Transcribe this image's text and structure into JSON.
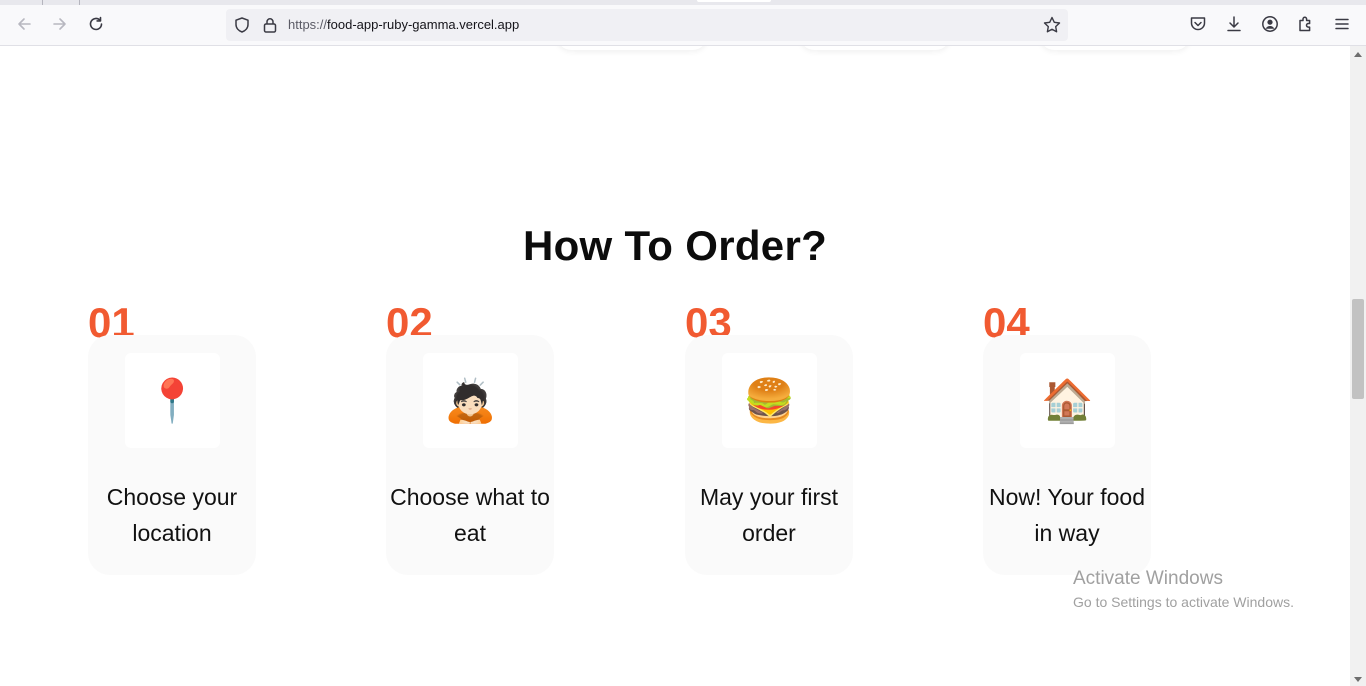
{
  "browser": {
    "url_prefix": "https://",
    "url_host": "food-app-ruby-gamma.vercel.app"
  },
  "section": {
    "title": "How To Order?"
  },
  "steps": [
    {
      "number": "01",
      "icon": "📍",
      "icon_name": "location-pin-icon",
      "text": "Choose your location"
    },
    {
      "number": "02",
      "icon": "🙇🏻",
      "icon_name": "person-bowing-icon",
      "text": "Choose what to eat"
    },
    {
      "number": "03",
      "icon": "🍔",
      "icon_name": "burger-icon",
      "text": "May your first order"
    },
    {
      "number": "04",
      "icon": "🏠",
      "icon_name": "house-icon",
      "text": "Now! Your food in way"
    }
  ],
  "watermark": {
    "title": "Activate Windows",
    "subtitle": "Go to Settings to activate Windows."
  },
  "colors": {
    "accent": "#f15a31",
    "card_bg": "#fafafa",
    "heading": "#0c0c0c"
  }
}
